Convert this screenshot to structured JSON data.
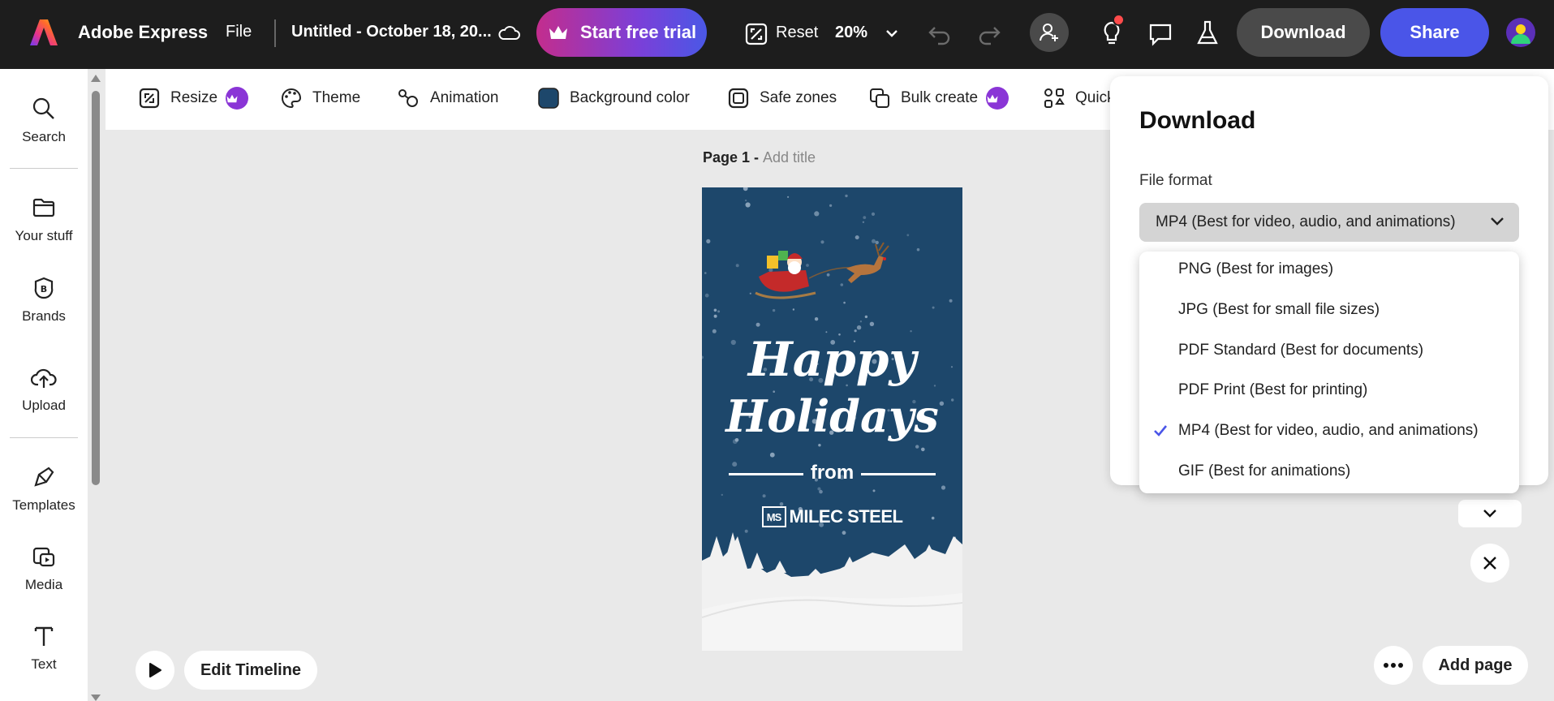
{
  "app": {
    "name": "Adobe Express",
    "file_menu": "File",
    "doc_title": "Untitled - October 18, 20...",
    "trial_label": "Start free trial",
    "reset_label": "Reset",
    "zoom_label": "20%",
    "download_label": "Download",
    "share_label": "Share"
  },
  "colors": {
    "topbar": "#1d1d1d",
    "trial_gradient": [
      "#c32d8d",
      "#4a58e6"
    ],
    "share": "#4a55e8",
    "artboard_bg": "#1d476b",
    "premium_badge": "#8a35d6",
    "check": "#4a55e8"
  },
  "sidebar": {
    "items": [
      {
        "label": "Search",
        "icon": "search-icon"
      },
      {
        "label": "Your stuff",
        "icon": "folder-icon"
      },
      {
        "label": "Brands",
        "icon": "brand-icon"
      },
      {
        "label": "Upload",
        "icon": "upload-icon"
      },
      {
        "label": "Templates",
        "icon": "templates-icon"
      },
      {
        "label": "Media",
        "icon": "media-icon"
      },
      {
        "label": "Text",
        "icon": "text-icon"
      }
    ]
  },
  "toolbar": {
    "items": [
      {
        "label": "Resize",
        "icon": "resize-icon",
        "premium": true
      },
      {
        "label": "Theme",
        "icon": "palette-icon",
        "premium": false
      },
      {
        "label": "Animation",
        "icon": "animation-icon",
        "premium": false
      },
      {
        "label": "Background color",
        "icon": "color-swatch-icon",
        "premium": false
      },
      {
        "label": "Safe zones",
        "icon": "safe-zones-icon",
        "premium": false
      },
      {
        "label": "Bulk create",
        "icon": "bulk-create-icon",
        "premium": true
      },
      {
        "label": "Quick",
        "icon": "quick-actions-icon",
        "premium": false
      }
    ]
  },
  "canvas": {
    "page_label": "Page 1 - ",
    "page_title_placeholder": "Add title",
    "artboard": {
      "line1": "Happy",
      "line2": "Holidays",
      "from": "from",
      "brand_mark": "MS",
      "brand_name": "MILEC STEEL"
    },
    "edit_timeline_label": "Edit Timeline",
    "add_page_label": "Add page"
  },
  "download_panel": {
    "title": "Download",
    "file_format_label": "File format",
    "selected_format": "MP4 (Best for video, audio, and animations)",
    "options": [
      {
        "label": "PNG (Best for images)",
        "selected": false
      },
      {
        "label": "JPG (Best for small file sizes)",
        "selected": false
      },
      {
        "label": "PDF Standard (Best for documents)",
        "selected": false
      },
      {
        "label": "PDF Print (Best for printing)",
        "selected": false
      },
      {
        "label": "MP4 (Best for video, audio, and animations)",
        "selected": true
      },
      {
        "label": "GIF (Best for animations)",
        "selected": false
      }
    ]
  }
}
